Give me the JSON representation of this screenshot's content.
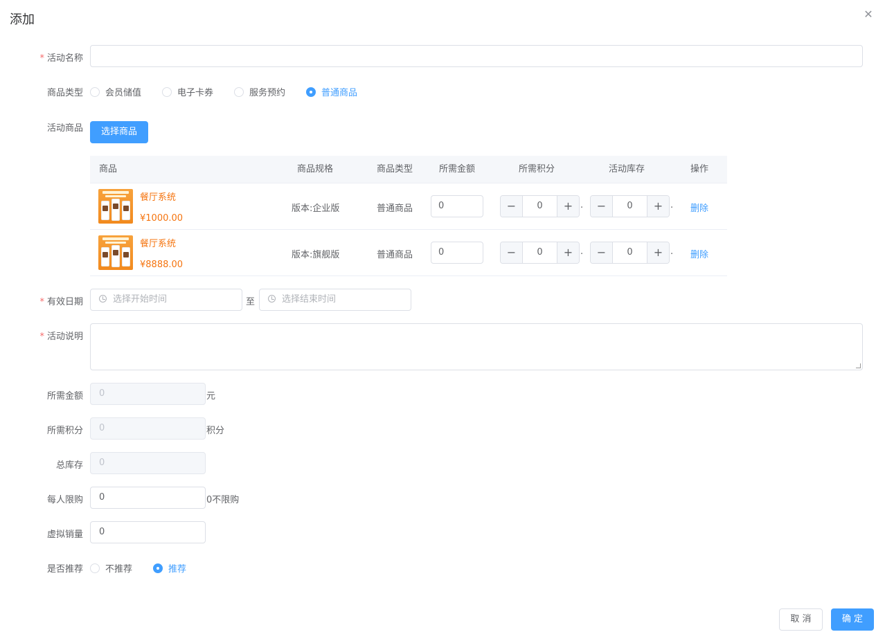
{
  "dialog": {
    "title": "添加",
    "close_icon": "close-icon"
  },
  "form": {
    "activity_name": {
      "label": "活动名称",
      "value": ""
    },
    "product_type": {
      "label": "商品类型",
      "options": [
        "会员储值",
        "电子卡券",
        "服务预约",
        "普通商品"
      ],
      "selected": "普通商品"
    },
    "activity_products": {
      "label": "活动商品",
      "select_button": "选择商品"
    },
    "valid_date": {
      "label": "有效日期",
      "start_placeholder": "选择开始时间",
      "separator": "至",
      "end_placeholder": "选择结束时间"
    },
    "description": {
      "label": "活动说明",
      "value": ""
    },
    "required_amount": {
      "label": "所需金额",
      "value": "0",
      "suffix": "元"
    },
    "required_points": {
      "label": "所需积分",
      "value": "0",
      "suffix": "积分"
    },
    "total_stock": {
      "label": "总库存",
      "value": "0"
    },
    "per_person_limit": {
      "label": "每人限购",
      "value": "0",
      "suffix": "0不限购"
    },
    "virtual_sales": {
      "label": "虚拟销量",
      "value": "0"
    },
    "recommend": {
      "label": "是否推荐",
      "options": [
        "不推荐",
        "推荐"
      ],
      "selected": "推荐"
    }
  },
  "table": {
    "columns": [
      "商品",
      "商品规格",
      "商品类型",
      "所需金额",
      "所需积分",
      "活动库存",
      "操作"
    ],
    "rows": [
      {
        "name": "餐厅系统",
        "price": "¥1000.00",
        "spec": "版本:企业版",
        "type": "普通商品",
        "amount": "0",
        "points": "0",
        "stock": "0",
        "action": "删除"
      },
      {
        "name": "餐厅系统",
        "price": "¥8888.00",
        "spec": "版本:旗舰版",
        "type": "普通商品",
        "amount": "0",
        "points": "0",
        "stock": "0",
        "action": "删除"
      }
    ]
  },
  "footer": {
    "cancel_label": "取 消",
    "confirm_label": "确 定"
  },
  "colors": {
    "primary": "#409eff",
    "price": "#f5740f",
    "required": "#f56c6c"
  }
}
